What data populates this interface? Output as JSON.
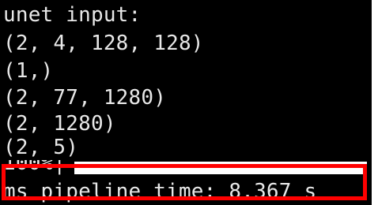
{
  "terminal": {
    "lines": [
      "unet input:",
      "(2, 4, 128, 128)",
      "(1,)",
      "(2, 77, 1280)",
      "(2, 1280)",
      "(2, 5)"
    ],
    "progress": {
      "label": "100%|",
      "fraction": 1.0
    },
    "status": "ms pipeline time: 8.367 s"
  },
  "annotation": {
    "color": "#ff0000"
  }
}
